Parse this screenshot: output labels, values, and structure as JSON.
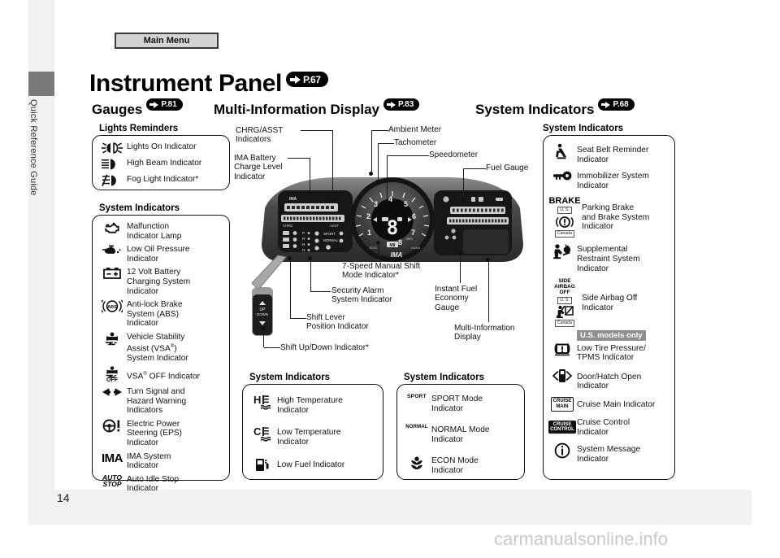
{
  "nav": {
    "main_menu": "Main Menu"
  },
  "sidebar": {
    "label": "Quick Reference Guide"
  },
  "page": {
    "number": "14",
    "watermark": "carmanualsonline.info"
  },
  "title": {
    "text": "Instrument Panel",
    "page_ref": "P.67"
  },
  "sections": {
    "gauges": {
      "title": "Gauges",
      "page_ref": "P.81"
    },
    "mid": {
      "title": "Multi-Information Display",
      "page_ref": "P.83"
    },
    "right": {
      "title": "System Indicators",
      "page_ref": "P.68"
    }
  },
  "boxes": {
    "lights_reminders": {
      "label": "Lights Reminders",
      "items": [
        {
          "icon": "lights-on-icon",
          "text": "Lights On Indicator"
        },
        {
          "icon": "high-beam-icon",
          "text": "High Beam Indicator"
        },
        {
          "icon": "fog-light-icon",
          "text": "Fog Light Indicator*"
        }
      ]
    },
    "left_system_indicators": {
      "label": "System Indicators",
      "items": [
        {
          "icon": "malfunction-indicator-icon",
          "text": "Malfunction\nIndicator Lamp"
        },
        {
          "icon": "low-oil-pressure-icon",
          "text": "Low Oil Pressure\nIndicator"
        },
        {
          "icon": "battery-charging-icon",
          "text": "12 Volt Battery\nCharging System\nIndicator"
        },
        {
          "icon": "abs-icon",
          "text": "Anti-lock Brake\nSystem (ABS)\nIndicator"
        },
        {
          "icon": "vsa-icon",
          "text": "Vehicle Stability\nAssist (VSA®)\nSystem Indicator"
        },
        {
          "icon": "vsa-off-icon",
          "text": "VSA® OFF Indicator"
        },
        {
          "icon": "turn-signal-icon",
          "text": "Turn Signal and\nHazard Warning\nIndicators"
        },
        {
          "icon": "eps-icon",
          "text": "Electric Power\nSteering (EPS)\nIndicator"
        },
        {
          "icon": "ima-icon",
          "text": "IMA System\nIndicator"
        },
        {
          "icon": "auto-idle-stop-icon",
          "text": "Auto Idle Stop\nIndicator"
        }
      ]
    },
    "temp_fuel": {
      "label": "System Indicators",
      "items": [
        {
          "icon": "high-temperature-icon",
          "text": "High Temperature\nIndicator"
        },
        {
          "icon": "low-temperature-icon",
          "text": "Low Temperature\nIndicator"
        },
        {
          "icon": "low-fuel-icon",
          "text": "Low Fuel Indicator"
        }
      ]
    },
    "modes": {
      "label": "System Indicators",
      "items": [
        {
          "icon": "sport-mode-icon",
          "text": "SPORT Mode\nIndicator"
        },
        {
          "icon": "normal-mode-icon",
          "text": "NORMAL Mode\nIndicator"
        },
        {
          "icon": "econ-mode-icon",
          "text": "ECON Mode\nIndicator"
        }
      ]
    },
    "right_system_indicators": {
      "label": "System Indicators",
      "items": [
        {
          "icon": "seat-belt-reminder-icon",
          "text": "Seat Belt Reminder\nIndicator"
        },
        {
          "icon": "immobilizer-icon",
          "text": "Immobilizer System\nIndicator"
        },
        {
          "icon": "parking-brake-icon",
          "text": "Parking Brake\nand Brake System\nIndicator"
        },
        {
          "icon": "srs-airbag-icon",
          "text": "Supplemental\nRestraint System\nIndicator"
        },
        {
          "icon": "side-airbag-off-icon",
          "text": "Side Airbag Off\nIndicator"
        },
        {
          "icon": "tpms-icon",
          "text": "Low Tire Pressure/\nTPMS Indicator"
        },
        {
          "icon": "door-hatch-open-icon",
          "text": "Door/Hatch Open\nIndicator"
        },
        {
          "icon": "cruise-main-icon",
          "text": "Cruise Main Indicator"
        },
        {
          "icon": "cruise-control-icon",
          "text": "Cruise Control\nIndicator"
        },
        {
          "icon": "system-message-icon",
          "text": "System Message\nIndicator"
        }
      ],
      "badges": {
        "us": "U. S.",
        "canada": "Canada",
        "us_models_only": "U.S. models only",
        "brake": "BRAKE",
        "side_airbag_off": "SIDE\nAIRBAG\nOFF",
        "cruise_main": "CRUISE\nMAIN",
        "cruise_control": "CRUISE\nCONTROL"
      }
    }
  },
  "callouts": {
    "chrg_asst": "CHRG/ASST\nIndicators",
    "ima_battery": "IMA Battery\nCharge Level\nIndicator",
    "ambient_meter": "Ambient Meter",
    "tachometer": "Tachometer",
    "speedometer": "Speedometer",
    "fuel_gauge": "Fuel Gauge",
    "seven_speed": "7-Speed Manual Shift\nMode Indicator*",
    "security_alarm": "Security Alarm\nSystem Indicator",
    "shift_lever": "Shift Lever\nPosition Indicator",
    "shift_updown": "Shift Up/Down Indicator*",
    "instant_fuel": "Instant Fuel\nEconomy\nGauge",
    "mid": "Multi-Information\nDisplay"
  },
  "cluster": {
    "tach_ticks": [
      "1",
      "2",
      "3",
      "4",
      "5",
      "6",
      "7",
      "8"
    ],
    "gear_display": "8",
    "mode_badge": "M8",
    "ima_label": "IMA",
    "chrg_label": "CHRG",
    "asst_label": "ASST",
    "shift_labels": [
      "P",
      "R",
      "N",
      "D"
    ],
    "sport_label": "SPORT",
    "normal_label": "NORMAL",
    "lever": {
      "up": "UP",
      "down": "DOWN"
    }
  },
  "colors": {
    "page_bg": "#f1f1f1",
    "sheet": "#ffffff",
    "ink": "#111111",
    "tab": "#7a7a7a",
    "badge_gray": "#8f8f8f",
    "watermark": "#c9c9c9"
  }
}
